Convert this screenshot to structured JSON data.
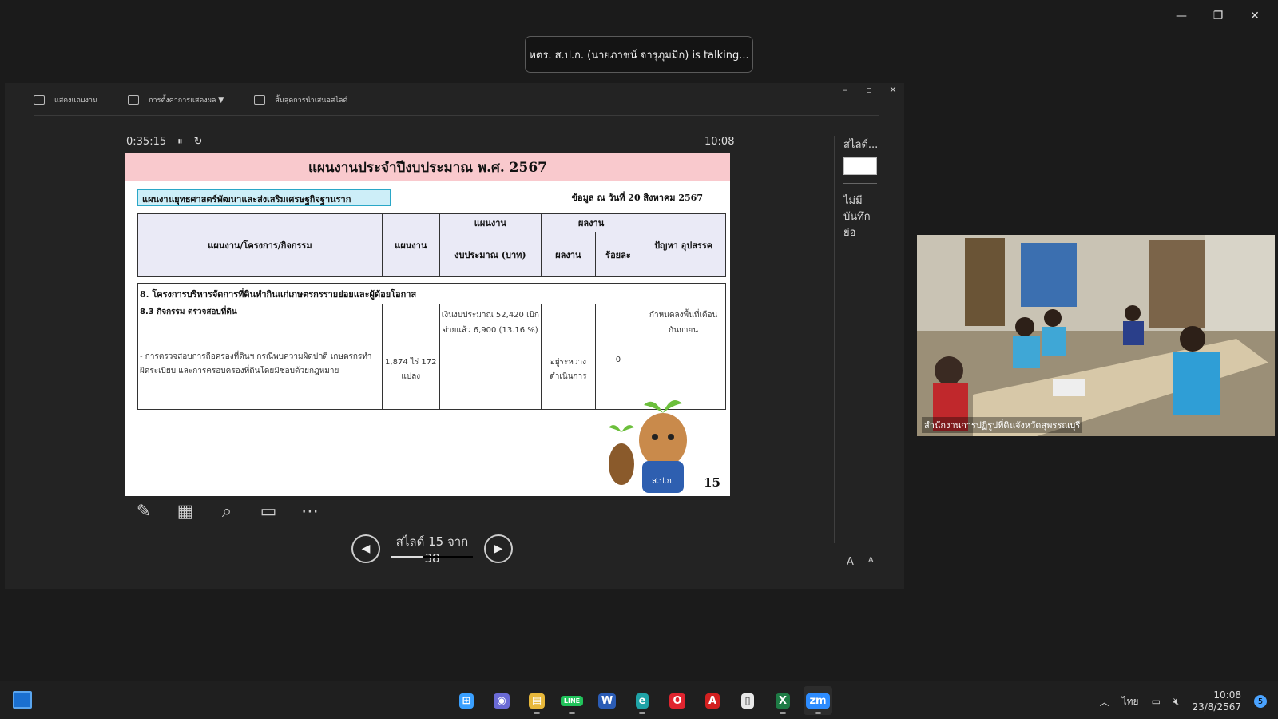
{
  "window": {
    "minimize": "—",
    "restore": "❐",
    "close": "✕"
  },
  "toast": {
    "text": "หตร. ส.ป.ก. (นายภาชน์  จารุภุมมิก) is talking..."
  },
  "presenter": {
    "toolbar": [
      {
        "label": "แสดงแถบงาน",
        "icon": "taskbar-icon"
      },
      {
        "label": "การตั้งค่าการแสดงผล ▼",
        "icon": "display-settings-icon"
      },
      {
        "label": "สิ้นสุดการนำเสนอสไลด์",
        "icon": "end-slideshow-icon"
      }
    ],
    "controls": {
      "min": "–",
      "restore": "▫",
      "close": "✕"
    },
    "elapsed": "0:35:15",
    "pause": "⏸",
    "restart": "↻",
    "clock": "10:08",
    "nav": {
      "slide_label": "สไลด์ 15 จาก 38",
      "prev": "◀",
      "next": "▶",
      "progress": 0.39
    },
    "tools": [
      "pen-icon",
      "grid-icon",
      "zoom-icon",
      "screen-icon",
      "more-icon"
    ],
    "right_panel": {
      "title": "สไลด์...",
      "notes": "ไม่มีบันทึกย่อ",
      "font_up": "A",
      "font_down": "A"
    }
  },
  "slide": {
    "title": "แผนงานประจำปีงบประมาณ พ.ศ. 2567",
    "strategy": "แผนงานยุทธศาสตร์พัฒนาและส่งเสริมเศรษฐกิจฐานราก",
    "as_of": "ข้อมูล ณ วันที่ 20 สิงหาคม 2567",
    "headers": {
      "project": "แผนงาน/โครงการ/กิจกรรม",
      "plan": "แผนงาน",
      "plan_group": "แผนงาน",
      "budget": "งบประมาณ (บาท)",
      "result_group": "ผลงาน",
      "result": "ผลงาน",
      "percent": "ร้อยละ",
      "problems": "ปัญหา อุปสรรค"
    },
    "section": "8. โครงการบริหารจัดการที่ดินทำกินแก่เกษตรกรรายย่อยและผู้ด้อยโอกาส",
    "activity": "8.3 กิจกรรม ตรวจสอบที่ดิน",
    "item": "- การตรวจสอบการถือครองที่ดินฯ กรณีพบความผิดปกติ เกษตรกรทำผิดระเบียบ และการครอบครองที่ดินโดยมิชอบด้วยกฎหมาย",
    "plan_value": "1,874 ไร่ 172 แปลง",
    "budget_value": "เงินงบประมาณ 52,420 เบิกจ่ายแล้ว 6,900 (13.16 %)",
    "result_value": "อยู่ระหว่างดำเนินการ",
    "percent_value": "0",
    "problem_value": "กำหนดลงพื้นที่เดือนกันยายน",
    "page_number": "15",
    "mascot_text": "ส.ป.ก."
  },
  "camera": {
    "label": "สำนักงานการปฏิรูปที่ดินจังหวัดสุพรรณบุรี"
  },
  "taskbar": {
    "apps": [
      {
        "name": "start",
        "glyph": "⊞",
        "color": "#3aa0ff"
      },
      {
        "name": "teams",
        "glyph": "◉",
        "color": "#6b6bd6"
      },
      {
        "name": "explorer",
        "glyph": "▤",
        "color": "#e8b83a"
      },
      {
        "name": "line",
        "glyph": "LINE",
        "color": "#21c35b"
      },
      {
        "name": "word",
        "glyph": "W",
        "color": "#2b5cb5"
      },
      {
        "name": "edge",
        "glyph": "e",
        "color": "#1fa3a7"
      },
      {
        "name": "opera",
        "glyph": "O",
        "color": "#e0242f"
      },
      {
        "name": "acrobat",
        "glyph": "A",
        "color": "#d32020"
      },
      {
        "name": "notepad",
        "glyph": "▯",
        "color": "#e8e8e8"
      },
      {
        "name": "excel",
        "glyph": "X",
        "color": "#1e7b45"
      },
      {
        "name": "zoom",
        "glyph": "zm",
        "color": "#2d8cff"
      }
    ],
    "lang": "ไทย",
    "time": "10:08",
    "date": "23/8/2567",
    "notifications": "5"
  }
}
